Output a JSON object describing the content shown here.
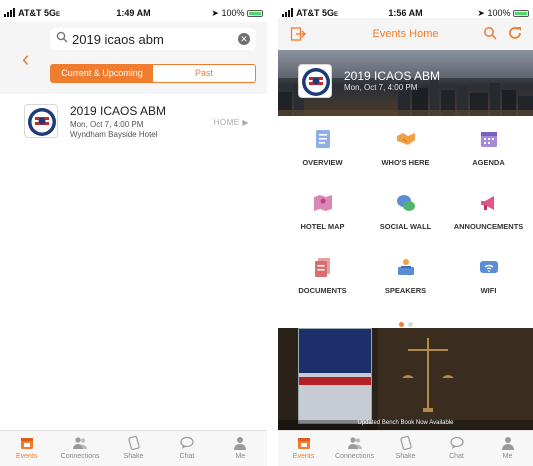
{
  "left": {
    "status": {
      "carrier": "AT&T 5G",
      "network_suffix": "E",
      "time": "1:49 AM",
      "battery": "100%"
    },
    "search": {
      "value": "2019 icaos abm"
    },
    "segments": {
      "current": "Current & Upcoming",
      "past": "Past"
    },
    "event": {
      "title": "2019 ICAOS ABM",
      "date": "Mon, Oct 7, 4:00 PM",
      "venue": "Wyndham Bayside Hotel",
      "home_label": "HOME ▶"
    }
  },
  "right": {
    "status": {
      "carrier": "AT&T 5G",
      "network_suffix": "E",
      "time": "1:56 AM",
      "battery": "100%"
    },
    "header": {
      "title": "Events Home"
    },
    "banner": {
      "title": "2019 ICAOS ABM",
      "date": "Mon, Oct 7, 4:00 PM"
    },
    "tiles": [
      {
        "label": "OVERVIEW",
        "icon": "overview-icon"
      },
      {
        "label": "WHO'S HERE",
        "icon": "handshake-icon"
      },
      {
        "label": "AGENDA",
        "icon": "calendar-icon"
      },
      {
        "label": "HOTEL MAP",
        "icon": "map-icon"
      },
      {
        "label": "SOCIAL WALL",
        "icon": "chat-bubbles-icon"
      },
      {
        "label": "ANNOUNCEMENTS",
        "icon": "megaphone-icon"
      },
      {
        "label": "DOCUMENTS",
        "icon": "documents-icon"
      },
      {
        "label": "SPEAKERS",
        "icon": "speaker-icon"
      },
      {
        "label": "WIFI",
        "icon": "wifi-icon"
      }
    ],
    "carousel": {
      "active_page": 1,
      "page_count": 2
    },
    "ad": {
      "caption": "Updated Bench Book Now Available"
    }
  },
  "tabbar": [
    {
      "label": "Events",
      "icon": "calendar-icon",
      "active": true
    },
    {
      "label": "Connections",
      "icon": "people-icon",
      "active": false
    },
    {
      "label": "Shake",
      "icon": "shake-icon",
      "active": false
    },
    {
      "label": "Chat",
      "icon": "chat-icon",
      "active": false
    },
    {
      "label": "Me",
      "icon": "person-icon",
      "active": false
    }
  ],
  "colors": {
    "accent": "#f07c2f",
    "tile_blue": "#5b8dd6",
    "tile_orange": "#f0a146",
    "tile_purple": "#8c67c9",
    "tile_pink": "#e0568a"
  }
}
